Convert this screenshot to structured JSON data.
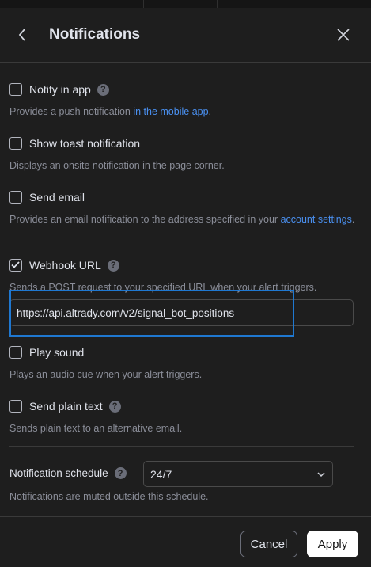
{
  "dialog": {
    "title": "Notifications"
  },
  "options": [
    {
      "label": "Notify in app",
      "checked": false,
      "desc_before": "Provides a push notification ",
      "desc_link": "in the mobile app",
      "desc_after": "."
    },
    {
      "label": "Show toast notification",
      "checked": false,
      "desc": "Displays an onsite notification in the page corner."
    },
    {
      "label": "Send email",
      "checked": false,
      "desc_before": "Provides an email notification to the address specified in your ",
      "desc_link": "account settings",
      "desc_after": "."
    },
    {
      "label": "Webhook URL",
      "checked": true,
      "desc": "Sends a POST request to your specified URL when your alert triggers."
    },
    {
      "label": "Play sound",
      "checked": false,
      "desc": "Plays an audio cue when your alert triggers."
    },
    {
      "label": "Send plain text",
      "checked": false,
      "desc": "Sends plain text to an alternative email."
    }
  ],
  "webhook": {
    "value": "https://api.altrady.com/v2/signal_bot_positions"
  },
  "schedule": {
    "label": "Notification schedule",
    "value": "24/7",
    "desc": "Notifications are muted outside this schedule."
  },
  "footer": {
    "cancel_label": "Cancel",
    "apply_label": "Apply"
  },
  "colors": {
    "background": "#1e1e1e",
    "link": "#4a90f0",
    "focus": "#1f78d1"
  }
}
